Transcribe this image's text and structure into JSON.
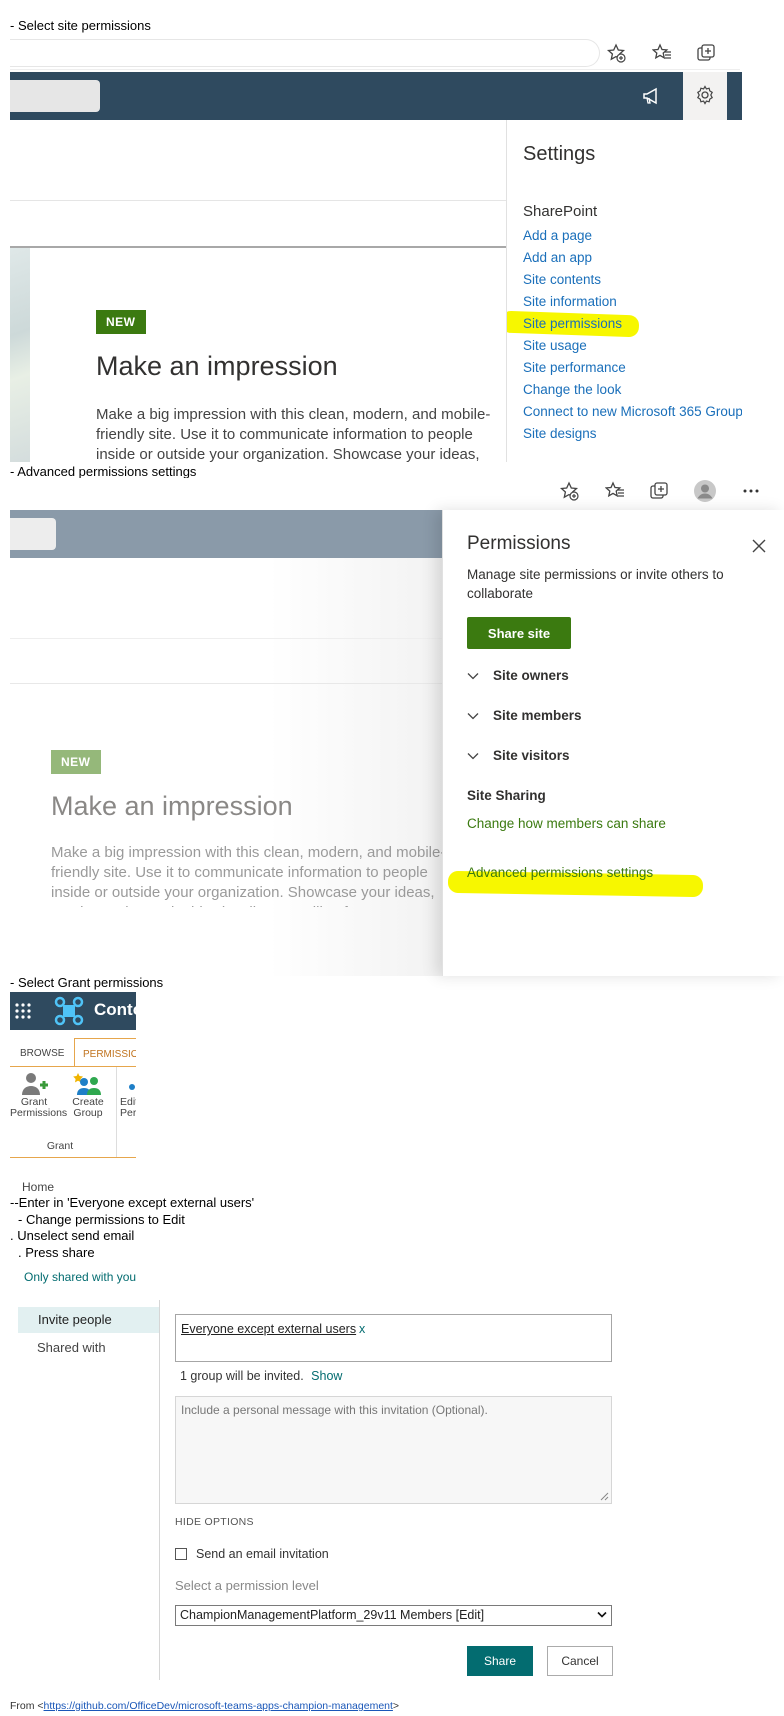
{
  "captions": {
    "step1": "- Select site permissions",
    "step2": "- Advanced permissions settings",
    "step3": "- Select Grant permissions",
    "step4a": "--Enter in 'Everyone except external users'",
    "step4b": "- Change permissions to Edit",
    "step4c": ". Unselect send email",
    "step4d": ". Press share"
  },
  "section1": {
    "badge": "NEW",
    "title": "Make an impression",
    "body": "Make a big impression with this clean, modern, and mobile-friendly site. Use it to communicate information to people inside or outside your organization. Showcase your ideas, results, and more in this visually compelling format.",
    "settings": {
      "title": "Settings",
      "section": "SharePoint",
      "links": [
        "Add a page",
        "Add an app",
        "Site contents",
        "Site information",
        "Site permissions",
        "Site usage",
        "Site performance",
        "Change the look",
        "Connect to new Microsoft 365 Group",
        "Site designs"
      ]
    }
  },
  "section2": {
    "badge": "NEW",
    "title": "Make an impression",
    "body": "Make a big impression with this clean, modern, and mobile-friendly site. Use it to communicate information to people inside or outside your organization. Showcase your ideas, results, and more in this visually compelling format.",
    "panel": {
      "title": "Permissions",
      "description": "Manage site permissions or invite others to collaborate",
      "share_button": "Share site",
      "groups": [
        "Site owners",
        "Site members",
        "Site visitors"
      ],
      "sharing_heading": "Site Sharing",
      "sharing_link": "Change how members can share",
      "advanced_link": "Advanced permissions settings"
    }
  },
  "section3": {
    "site_title": "Contoso",
    "tabs": {
      "browse": "BROWSE",
      "permissions": "PERMISSIONS"
    },
    "ribbon": {
      "grant_1": "Grant",
      "grant_2": "Permissions",
      "create_1": "Create",
      "create_2": "Group",
      "edit_1": "Edit",
      "edit_2": "Permissions",
      "group_label": "Grant"
    },
    "home": "Home",
    "only_shared": "Only shared with you",
    "nav": {
      "invite": "Invite people",
      "shared": "Shared with"
    },
    "invitee": "Everyone except external users",
    "remove": "x",
    "invite_count": "1 group will be invited.",
    "show": "Show",
    "message_placeholder": "Include a personal message with this invitation (Optional).",
    "hide_options": "HIDE OPTIONS",
    "send_email": "Send an email invitation",
    "select_label": "Select a permission level",
    "permission_level": "ChampionManagementPlatform_29v11 Members [Edit]",
    "share_button": "Share",
    "cancel_button": "Cancel"
  },
  "footer": {
    "from": "From <",
    "url": "https://github.com/OfficeDev/microsoft-teams-apps-champion-management",
    "close": ">"
  },
  "colors": {
    "suitebar": "#2f4a5f",
    "sp_green": "#3b7a10",
    "link_blue": "#1a6fba",
    "highlight": "#f7f700",
    "teal": "#036c70"
  }
}
